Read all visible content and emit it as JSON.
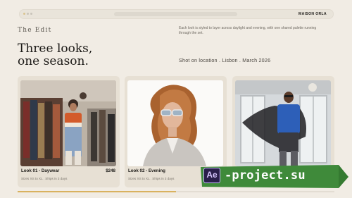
{
  "topbar": {
    "brand": "MAISON ORLA"
  },
  "hero": {
    "eyebrow": "The Edit",
    "description": "Each look is styled to layer across daylight and evening, with one shared palette running through the set.",
    "headline_line1": "Three looks,",
    "headline_line2": "one season.",
    "shot_info": "Shot on location . Lisbon . March 2026"
  },
  "cards": [
    {
      "title": "Look 01 - Daywear",
      "price": "$248",
      "sizes": "Sizes XS to XL . Ships in 3 days"
    },
    {
      "title": "Look 02 - Evening",
      "price": "",
      "sizes": "Sizes XS to XL . Ships in 3 days"
    },
    {
      "title": "",
      "price": "",
      "sizes": ""
    }
  ],
  "progress": {
    "value": 0.5
  },
  "watermark": {
    "icon_text": "Ae",
    "text": "-project.su"
  },
  "colors": {
    "background": "#f1ece4",
    "card": "#e7e0d4",
    "accent": "#d9b25f",
    "watermark_green": "#3f8a3a"
  }
}
